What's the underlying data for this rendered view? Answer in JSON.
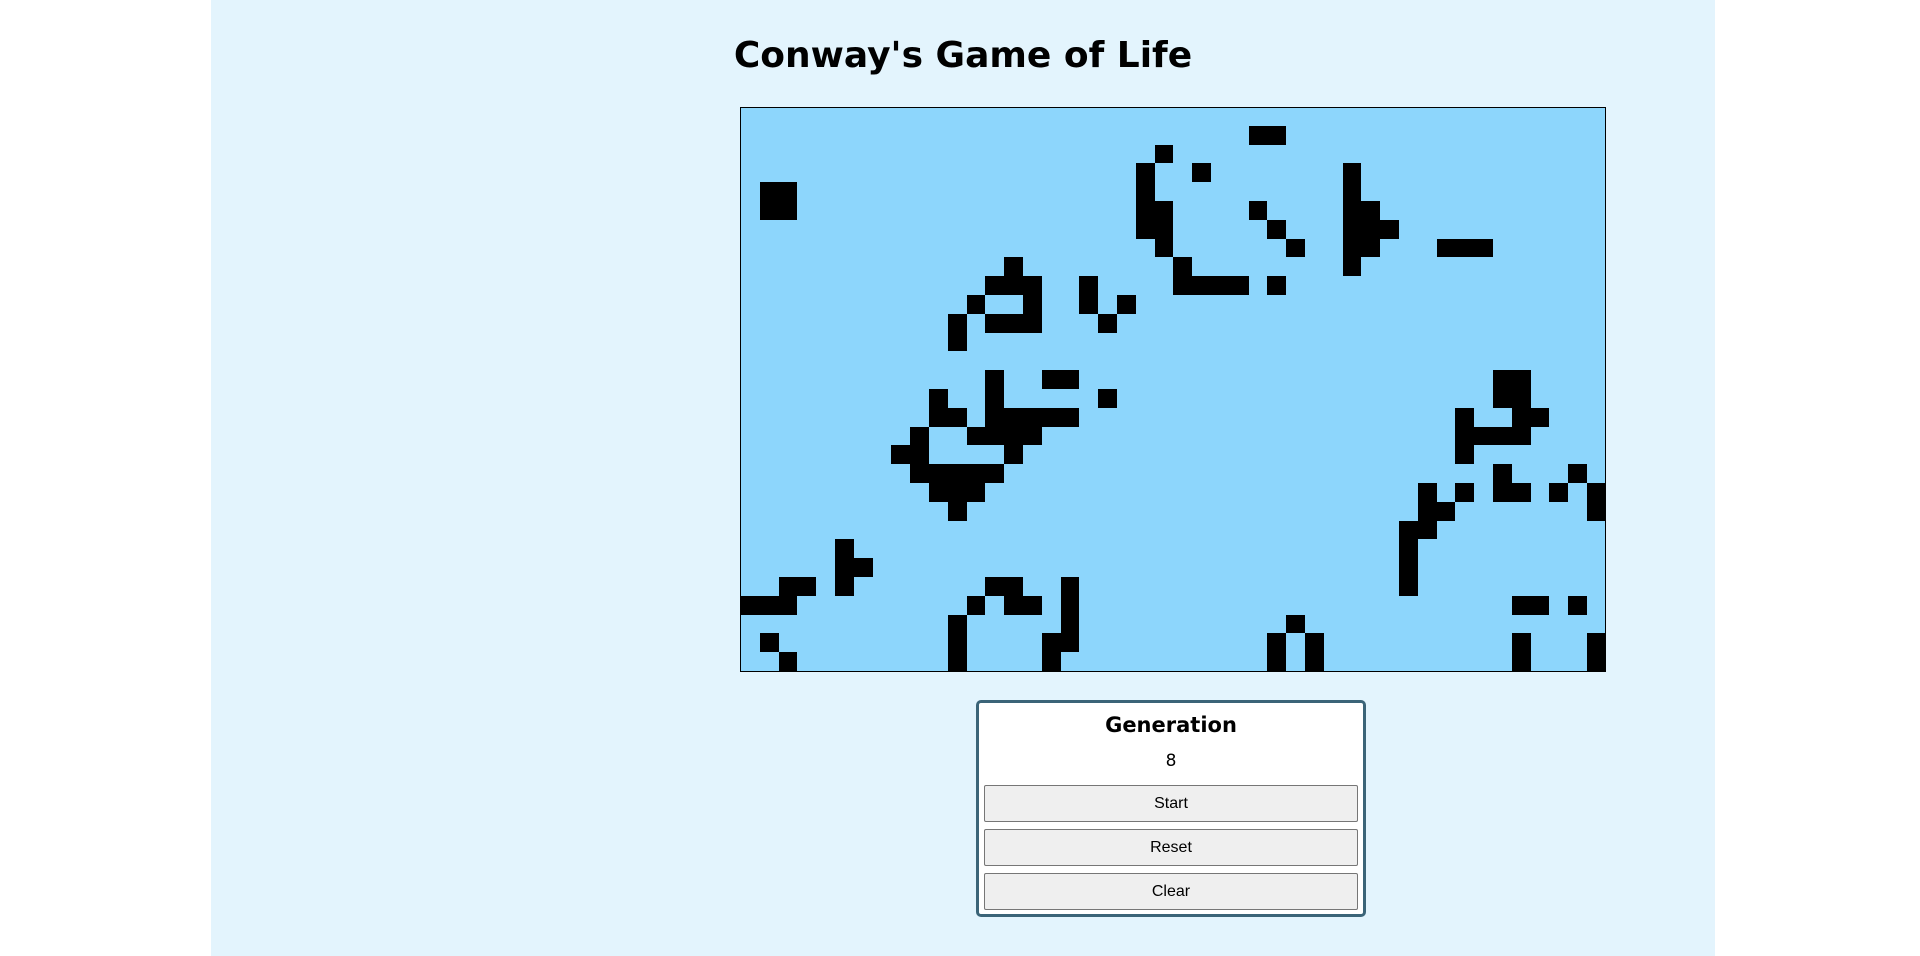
{
  "title": "Conway's Game of Life",
  "colors": {
    "page_background": "#e3f4fd",
    "board_background": "#8dd6fc",
    "live_cell": "#000000",
    "panel_border": "#3b6478"
  },
  "board": {
    "columns": 46,
    "rows": 30,
    "live_cells": [
      [
        1,
        27
      ],
      [
        1,
        28
      ],
      [
        2,
        22
      ],
      [
        3,
        21
      ],
      [
        3,
        24
      ],
      [
        3,
        32
      ],
      [
        4,
        1
      ],
      [
        4,
        2
      ],
      [
        4,
        21
      ],
      [
        4,
        32
      ],
      [
        5,
        1
      ],
      [
        5,
        2
      ],
      [
        5,
        21
      ],
      [
        5,
        22
      ],
      [
        5,
        27
      ],
      [
        5,
        32
      ],
      [
        5,
        33
      ],
      [
        6,
        21
      ],
      [
        6,
        22
      ],
      [
        6,
        28
      ],
      [
        6,
        32
      ],
      [
        6,
        33
      ],
      [
        6,
        34
      ],
      [
        7,
        22
      ],
      [
        7,
        29
      ],
      [
        7,
        32
      ],
      [
        7,
        33
      ],
      [
        7,
        37
      ],
      [
        7,
        38
      ],
      [
        7,
        39
      ],
      [
        8,
        14
      ],
      [
        8,
        23
      ],
      [
        8,
        32
      ],
      [
        9,
        13
      ],
      [
        9,
        14
      ],
      [
        9,
        15
      ],
      [
        9,
        18
      ],
      [
        9,
        23
      ],
      [
        9,
        24
      ],
      [
        9,
        25
      ],
      [
        9,
        26
      ],
      [
        9,
        28
      ],
      [
        10,
        12
      ],
      [
        10,
        15
      ],
      [
        10,
        18
      ],
      [
        10,
        20
      ],
      [
        11,
        11
      ],
      [
        11,
        13
      ],
      [
        11,
        14
      ],
      [
        11,
        15
      ],
      [
        11,
        19
      ],
      [
        12,
        11
      ],
      [
        14,
        13
      ],
      [
        14,
        16
      ],
      [
        14,
        17
      ],
      [
        14,
        40
      ],
      [
        14,
        41
      ],
      [
        15,
        10
      ],
      [
        15,
        13
      ],
      [
        15,
        19
      ],
      [
        15,
        40
      ],
      [
        15,
        41
      ],
      [
        16,
        10
      ],
      [
        16,
        11
      ],
      [
        16,
        13
      ],
      [
        16,
        14
      ],
      [
        16,
        15
      ],
      [
        16,
        16
      ],
      [
        16,
        17
      ],
      [
        16,
        38
      ],
      [
        16,
        41
      ],
      [
        16,
        42
      ],
      [
        17,
        9
      ],
      [
        17,
        12
      ],
      [
        17,
        13
      ],
      [
        17,
        14
      ],
      [
        17,
        15
      ],
      [
        17,
        38
      ],
      [
        17,
        39
      ],
      [
        17,
        40
      ],
      [
        17,
        41
      ],
      [
        18,
        8
      ],
      [
        18,
        9
      ],
      [
        18,
        14
      ],
      [
        18,
        38
      ],
      [
        19,
        9
      ],
      [
        19,
        10
      ],
      [
        19,
        11
      ],
      [
        19,
        12
      ],
      [
        19,
        13
      ],
      [
        19,
        40
      ],
      [
        19,
        44
      ],
      [
        20,
        10
      ],
      [
        20,
        11
      ],
      [
        20,
        12
      ],
      [
        20,
        36
      ],
      [
        20,
        38
      ],
      [
        20,
        40
      ],
      [
        20,
        41
      ],
      [
        20,
        43
      ],
      [
        20,
        45
      ],
      [
        21,
        11
      ],
      [
        21,
        36
      ],
      [
        21,
        37
      ],
      [
        21,
        45
      ],
      [
        22,
        35
      ],
      [
        22,
        36
      ],
      [
        23,
        5
      ],
      [
        23,
        35
      ],
      [
        24,
        5
      ],
      [
        24,
        6
      ],
      [
        24,
        35
      ],
      [
        25,
        2
      ],
      [
        25,
        3
      ],
      [
        25,
        5
      ],
      [
        25,
        13
      ],
      [
        25,
        14
      ],
      [
        25,
        17
      ],
      [
        25,
        35
      ],
      [
        26,
        0
      ],
      [
        26,
        1
      ],
      [
        26,
        2
      ],
      [
        26,
        12
      ],
      [
        26,
        14
      ],
      [
        26,
        15
      ],
      [
        26,
        17
      ],
      [
        26,
        41
      ],
      [
        26,
        42
      ],
      [
        26,
        44
      ],
      [
        27,
        11
      ],
      [
        27,
        17
      ],
      [
        27,
        29
      ],
      [
        28,
        1
      ],
      [
        28,
        11
      ],
      [
        28,
        16
      ],
      [
        28,
        17
      ],
      [
        28,
        28
      ],
      [
        28,
        30
      ],
      [
        28,
        41
      ],
      [
        28,
        45
      ],
      [
        29,
        2
      ],
      [
        29,
        11
      ],
      [
        29,
        16
      ],
      [
        29,
        28
      ],
      [
        29,
        30
      ],
      [
        29,
        41
      ],
      [
        29,
        45
      ]
    ]
  },
  "panel": {
    "generation_label": "Generation",
    "generation_value": "8",
    "start_label": "Start",
    "reset_label": "Reset",
    "clear_label": "Clear"
  }
}
